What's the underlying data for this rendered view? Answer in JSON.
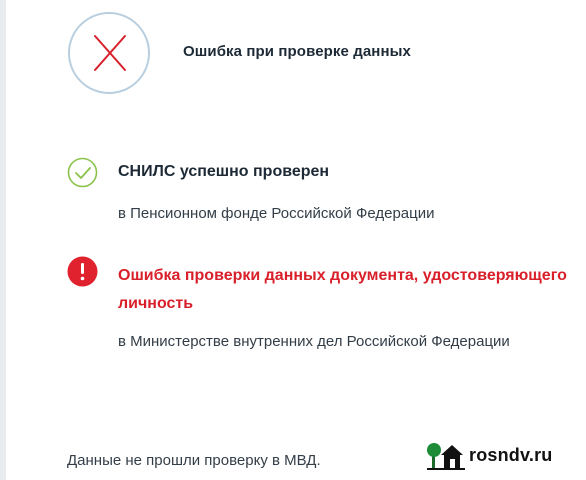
{
  "header": {
    "title": "Ошибка при проверке данных",
    "status_icon": "close-icon",
    "status_color": "#d81f2a"
  },
  "checks": [
    {
      "status": "success",
      "icon": "check-circle-icon",
      "title": "СНИЛС успешно проверен",
      "subtitle": "в Пенсионном фонде Российской Федерации",
      "title_color": "#1d2a36",
      "icon_color": "#8bc34a"
    },
    {
      "status": "error",
      "icon": "exclamation-circle-icon",
      "title": "Ошибка проверки данных документа, удостоверяющего\nличность",
      "subtitle": "в Министерстве внутренних дел Российской Федерации",
      "title_color": "#d81f2a",
      "icon_color": "#e0222e"
    }
  ],
  "footer": {
    "note": "Данные не прошли проверку в МВД."
  },
  "watermark": {
    "text": "rosndv.ru",
    "logo": "house-tree-logo"
  }
}
